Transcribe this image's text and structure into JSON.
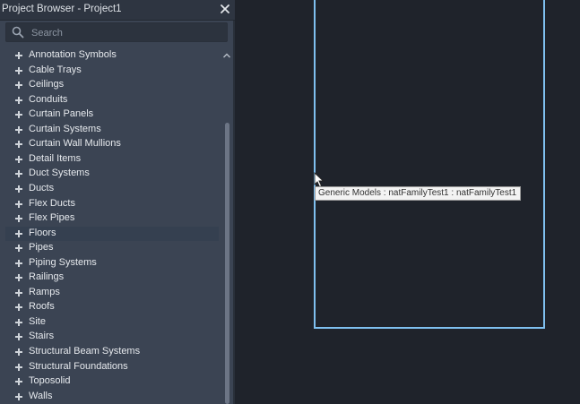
{
  "browser": {
    "title": "Project Browser - Project1",
    "search_placeholder": "Search",
    "items": [
      {
        "label": "Annotation Symbols"
      },
      {
        "label": "Cable Trays"
      },
      {
        "label": "Ceilings"
      },
      {
        "label": "Conduits"
      },
      {
        "label": "Curtain Panels"
      },
      {
        "label": "Curtain Systems"
      },
      {
        "label": "Curtain Wall Mullions"
      },
      {
        "label": "Detail Items"
      },
      {
        "label": "Duct Systems"
      },
      {
        "label": "Ducts"
      },
      {
        "label": "Flex Ducts"
      },
      {
        "label": "Flex Pipes"
      },
      {
        "label": "Floors",
        "highlighted": true
      },
      {
        "label": "Pipes"
      },
      {
        "label": "Piping Systems"
      },
      {
        "label": "Railings"
      },
      {
        "label": "Ramps"
      },
      {
        "label": "Roofs"
      },
      {
        "label": "Site"
      },
      {
        "label": "Stairs"
      },
      {
        "label": "Structural Beam Systems"
      },
      {
        "label": "Structural Foundations"
      },
      {
        "label": "Toposolid"
      },
      {
        "label": "Walls"
      }
    ]
  },
  "canvas": {
    "tooltip": "Generic Models : natFamilyTest1 : natFamilyTest1",
    "selection_color": "#7fc0f0"
  },
  "icons": {
    "close": "close-icon",
    "search": "search-icon",
    "expand": "plus-icon",
    "scroll_up": "chevron-up-icon",
    "cursor": "mouse-pointer-icon"
  }
}
